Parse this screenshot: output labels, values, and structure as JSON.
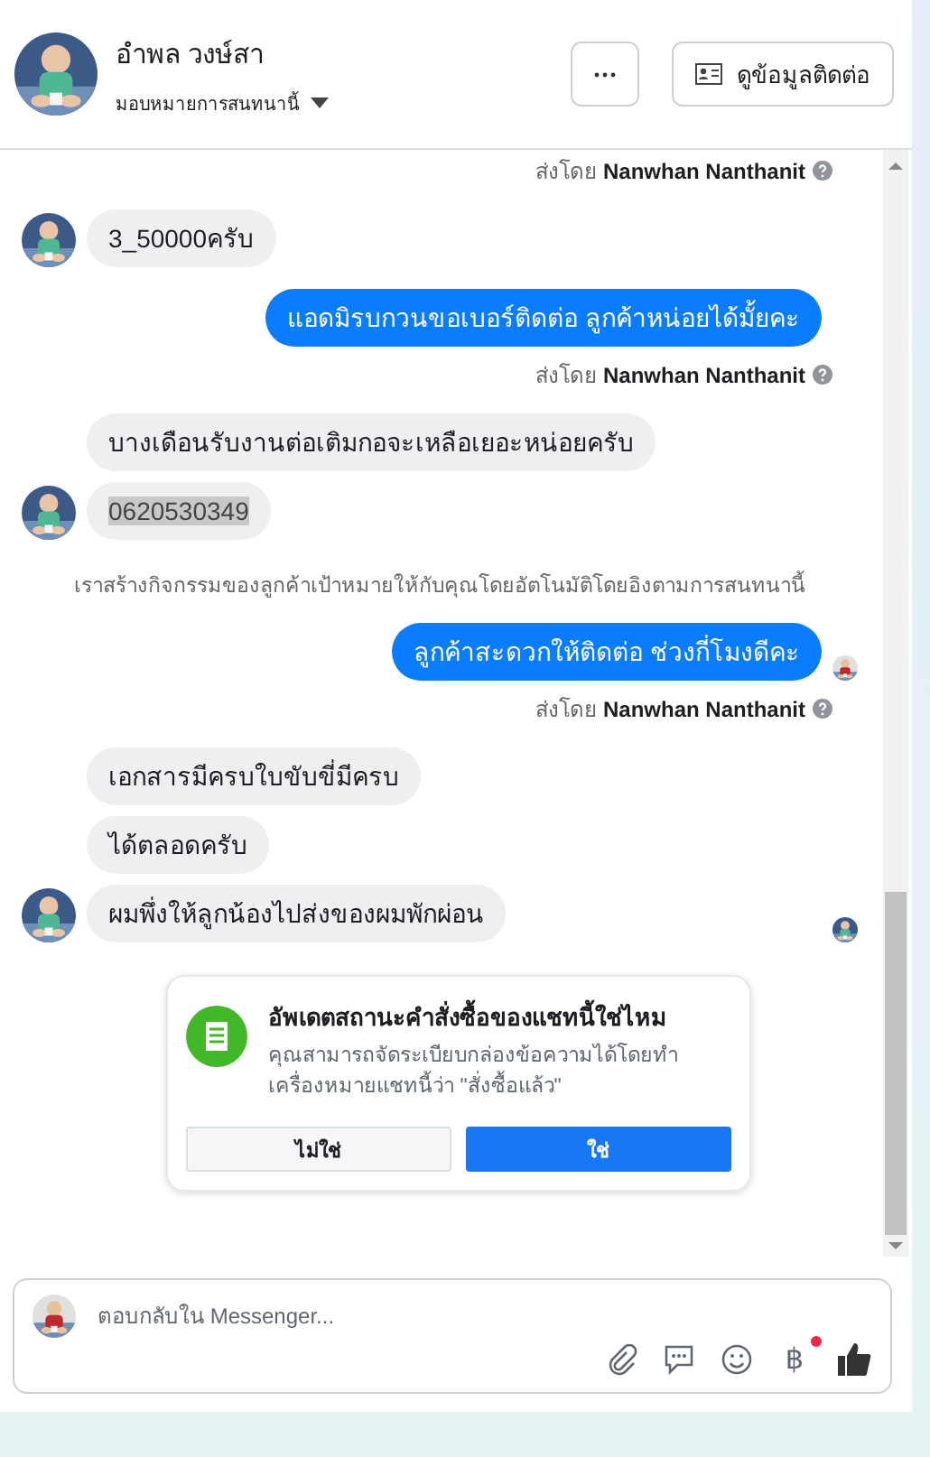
{
  "header": {
    "name": "อำพล วงษ์สา",
    "assign": "มอบหมายการสนทนานี้",
    "contact_button": "ดูข้อมูลติดต่อ"
  },
  "messages": [
    {
      "kind": "sent_by",
      "prefix": "ส่งโดย",
      "name": "Nanwhan Nanthanit"
    },
    {
      "kind": "in",
      "text": "3_50000ครับ",
      "avatar": true
    },
    {
      "kind": "out",
      "text": "แอดมิรบกวนขอเบอร์ติดต่อ ลูกค้าหน่อยได้มั้ยคะ",
      "seen": false
    },
    {
      "kind": "sent_by",
      "prefix": "ส่งโดย",
      "name": "Nanwhan Nanthanit"
    },
    {
      "kind": "in",
      "text": "บางเดือนรับงานต่อเติมกอจะเหลือเยอะหน่อยครับ",
      "avatar": false
    },
    {
      "kind": "in",
      "text": "0620530349",
      "avatar": true,
      "highlighted": true
    },
    {
      "kind": "system",
      "text": "เราสร้างกิจกรรมของลูกค้าเป้าหมายให้กับคุณโดยอัตโนมัติโดยอิงตามการสนทนานี้"
    },
    {
      "kind": "out",
      "text": "ลูกค้าสะดวกให้ติดต่อ ช่วงกี่โมงดีคะ",
      "seen": true
    },
    {
      "kind": "sent_by",
      "prefix": "ส่งโดย",
      "name": "Nanwhan Nanthanit"
    },
    {
      "kind": "in",
      "text": "เอกสารมีครบใบขับขี่มีครบ",
      "avatar": false
    },
    {
      "kind": "in",
      "text": "ได้ตลอดครับ",
      "avatar": false
    },
    {
      "kind": "in",
      "text": "ผมพึ่งให้ลูกน้องไปส่งของผมพักผ่อน",
      "avatar": true,
      "seen": true
    }
  ],
  "prompt": {
    "title": "อัพเดตสถานะคำสั่งซื้อของแชทนี้ใช่ไหม",
    "body": "คุณสามารถจัดระเบียบกล่องข้อความได้โดยทำเครื่องหมายแชทนี้ว่า \"สั่งซื้อแล้ว\"",
    "buttons": [
      {
        "label": "ไม่ใช่",
        "primary": false
      },
      {
        "label": "ใช่",
        "primary": true
      }
    ]
  },
  "composer": {
    "placeholder": "ตอบกลับใน Messenger...",
    "currency": "฿",
    "currency_badge": true
  }
}
